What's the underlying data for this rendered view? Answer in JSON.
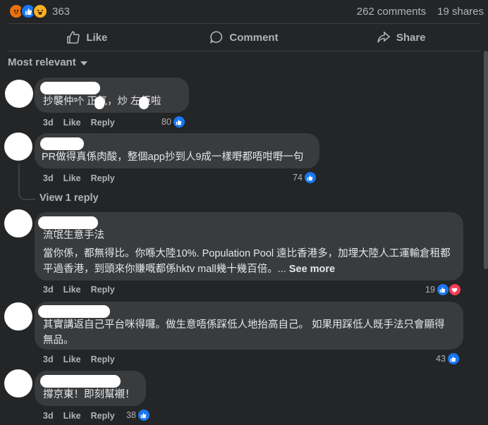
{
  "reactions": {
    "count": "363",
    "icons": [
      "angry-icon",
      "like-icon",
      "haha-icon"
    ]
  },
  "stats": {
    "comments": "262 comments",
    "shares": "19 shares"
  },
  "actions": {
    "like": "Like",
    "comment": "Comment",
    "share": "Share"
  },
  "sort_label": "Most relevant",
  "labels": {
    "age": "3d",
    "like": "Like",
    "reply": "Reply"
  },
  "comments": [
    {
      "text": "抄襲仲𠮶 正氣，炒 左佢啦",
      "reactions": "80"
    },
    {
      "text": "PR做得真係肉酸，整個app抄到人9成一樣嘢都唔咁嘢一句",
      "reactions": "74",
      "view_replies": "View 1 reply"
    },
    {
      "title": "流氓生意手法",
      "text": "當你係，都無得比。你喺大陸10%. Population Pool 遠比香港多，加埋大陸人工運輸倉租都平過香港，到頭來你賺嘅都係hktv mall幾十幾百倍。...",
      "see_more": "See more",
      "reactions": "19"
    },
    {
      "text": "其實講返自己平台咪得囉。做生意唔係踩低人地抬高自己。 如果用踩低人既手法只會顯得無品。",
      "reactions": "43"
    },
    {
      "text": "撐京東！即刻幫襯！",
      "reactions": "38"
    }
  ],
  "colors": {
    "background": "#242526",
    "bubble": "#3a3b3c",
    "accent": "#1877f2",
    "heart": "#f33e58"
  }
}
